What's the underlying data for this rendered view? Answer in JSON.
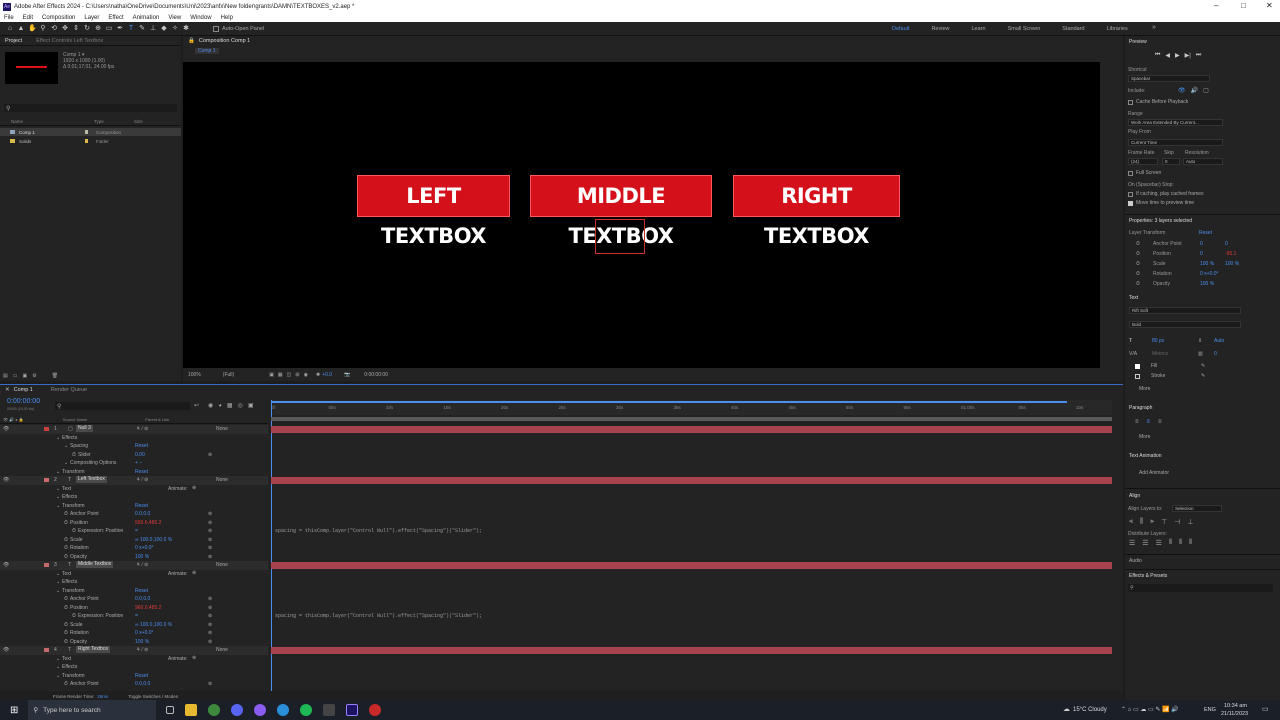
{
  "titlebar": {
    "title": "Adobe After Effects 2024 - C:\\Users\\natha\\OneDrive\\Documents\\Uni\\2023\\anfx\\New folder\\grants\\DAMN\\TEXTBOXES_v2.aep *"
  },
  "menu": [
    "File",
    "Edit",
    "Composition",
    "Layer",
    "Effect",
    "Animation",
    "View",
    "Window",
    "Help"
  ],
  "toolbar": {
    "auto_open": "Auto-Open Panel"
  },
  "workspaces": [
    "Default",
    "Review",
    "Learn",
    "Small Screen",
    "Standard",
    "Libraries"
  ],
  "project": {
    "tab": "Project",
    "effect_tab": "Effect Controls Left Textbox",
    "comp_name": "Comp 1 ▾",
    "comp_size": "1920 x 1080 (1.00)",
    "comp_duration": "Δ 0;01;17;01, 24.00 fps",
    "cols": [
      "Name",
      "Type",
      "Size"
    ],
    "items": [
      {
        "name": "Comp 1",
        "type": "Composition"
      },
      {
        "name": "Solids",
        "type": "Folder"
      }
    ]
  },
  "composition": {
    "tab": "Composition Comp 1",
    "crumb": "Comp 1"
  },
  "viewer": {
    "boxes": [
      "LEFT TEXTBOX",
      "MIDDLE TEXTBOX",
      "RIGHT TEXTBOX"
    ],
    "zoom": "100%",
    "quality": "(Full)",
    "exposure": "+0.0",
    "timecode": "0:00:00:00"
  },
  "preview": {
    "title": "Preview",
    "shortcut_label": "Shortcut",
    "shortcut": "Spacebar",
    "include": "Include:",
    "cache": "Cache Before Playback",
    "range_label": "Range",
    "range": "Work Area Extended By Current...",
    "play_from_label": "Play From",
    "play_from": "Current Time",
    "framerate_label": "Frame Rate",
    "skip_label": "Skip",
    "res_label": "Resolution",
    "framerate": "(24)",
    "skip": "0",
    "res": "Auto",
    "fullscreen": "Full Screen",
    "stop_label": "On (Spacebar) Stop:",
    "if_caching": "If caching, play cached frames",
    "move_time": "Move time to preview time"
  },
  "properties": {
    "title": "Properties: 3 layers selected",
    "layer_transform": "Layer Transform",
    "reset": "Reset",
    "rows": [
      {
        "label": "Anchor Point",
        "v1": "0",
        "v2": "0"
      },
      {
        "label": "Position",
        "v1": "0",
        "v2": "-95.1"
      },
      {
        "label": "Scale",
        "v1": "100 %",
        "v2": "100 %"
      },
      {
        "label": "Rotation",
        "v1": "0 x+0.0°",
        "v2": ""
      },
      {
        "label": "Opacity",
        "v1": "100 %",
        "v2": ""
      }
    ],
    "text_title": "Text",
    "font": "Rift Soft",
    "style": "Bold",
    "size": "80 px",
    "leading": "Auto",
    "kerning": "Metrics",
    "tracking": "0",
    "fill": "Fill",
    "stroke": "Stroke",
    "more": "More",
    "paragraph": "Paragraph",
    "text_animation": "Text Animation",
    "add_animator": "Add Animator",
    "align": "Align",
    "align_to_label": "Align Layers to:",
    "align_to": "Selection",
    "distribute": "Distribute Layers:",
    "audio": "Audio",
    "effects_presets": "Effects & Presets"
  },
  "timeline": {
    "tab": "Comp 1",
    "render_queue": "Render Queue",
    "time": "0:00:00:00",
    "fps": "00000 (24.00 fps)",
    "cols": {
      "source": "Source Name",
      "parent": "Parent & Link"
    },
    "ruler": [
      "0f",
      "05s",
      "10s",
      "15s",
      "20s",
      "25s",
      "30s",
      "35s",
      "40s",
      "45s",
      "50s",
      "55s",
      "01:00s",
      "05s",
      "10s"
    ],
    "none": "None",
    "animate": "Animate:",
    "expression": "spacing = thisComp.layer(\"Control Null\").effect(\"Spacing\")(\"Slider\");",
    "rows": [
      {
        "num": "1",
        "name": "Null 3",
        "indent": 0,
        "type": "layer",
        "value": ""
      },
      {
        "num": "",
        "name": "Effects",
        "indent": 1,
        "type": "group",
        "value": ""
      },
      {
        "num": "",
        "name": "Spacing",
        "indent": 2,
        "type": "group",
        "value": "Reset"
      },
      {
        "num": "",
        "name": "Slider",
        "indent": 3,
        "type": "prop",
        "value": "0.00"
      },
      {
        "num": "",
        "name": "Compositing Options",
        "indent": 2,
        "type": "group",
        "value": "+ −"
      },
      {
        "num": "",
        "name": "Transform",
        "indent": 1,
        "type": "group",
        "value": "Reset"
      },
      {
        "num": "2",
        "name": "Left Textbox",
        "indent": 0,
        "type": "layer",
        "value": ""
      },
      {
        "num": "",
        "name": "Text",
        "indent": 1,
        "type": "group",
        "value": ""
      },
      {
        "num": "",
        "name": "Effects",
        "indent": 1,
        "type": "group",
        "value": ""
      },
      {
        "num": "",
        "name": "Transform",
        "indent": 1,
        "type": "group",
        "value": "Reset"
      },
      {
        "num": "",
        "name": "Anchor Point",
        "indent": 2,
        "type": "prop",
        "value": "0.0,0.0"
      },
      {
        "num": "",
        "name": "Position",
        "indent": 2,
        "type": "prop",
        "value": "565.6,485.2",
        "red": true
      },
      {
        "num": "",
        "name": "Expression: Position",
        "indent": 3,
        "type": "prop",
        "value": "="
      },
      {
        "num": "",
        "name": "Scale",
        "indent": 2,
        "type": "prop",
        "value": "∞ 100.0,100.0 %"
      },
      {
        "num": "",
        "name": "Rotation",
        "indent": 2,
        "type": "prop",
        "value": "0 x+0.0°"
      },
      {
        "num": "",
        "name": "Opacity",
        "indent": 2,
        "type": "prop",
        "value": "100 %"
      },
      {
        "num": "3",
        "name": "Middle Textbox",
        "indent": 0,
        "type": "layer",
        "value": ""
      },
      {
        "num": "",
        "name": "Text",
        "indent": 1,
        "type": "group",
        "value": ""
      },
      {
        "num": "",
        "name": "Effects",
        "indent": 1,
        "type": "group",
        "value": ""
      },
      {
        "num": "",
        "name": "Transform",
        "indent": 1,
        "type": "group",
        "value": "Reset"
      },
      {
        "num": "",
        "name": "Anchor Point",
        "indent": 2,
        "type": "prop",
        "value": "0.0,0.0"
      },
      {
        "num": "",
        "name": "Position",
        "indent": 2,
        "type": "prop",
        "value": "960.0,485.2",
        "red": true
      },
      {
        "num": "",
        "name": "Expression: Position",
        "indent": 3,
        "type": "prop",
        "value": "="
      },
      {
        "num": "",
        "name": "Scale",
        "indent": 2,
        "type": "prop",
        "value": "∞ 100.0,100.0 %"
      },
      {
        "num": "",
        "name": "Rotation",
        "indent": 2,
        "type": "prop",
        "value": "0 x+0.0°"
      },
      {
        "num": "",
        "name": "Opacity",
        "indent": 2,
        "type": "prop",
        "value": "100 %"
      },
      {
        "num": "4",
        "name": "Right Textbox",
        "indent": 0,
        "type": "layer",
        "value": ""
      },
      {
        "num": "",
        "name": "Text",
        "indent": 1,
        "type": "group",
        "value": ""
      },
      {
        "num": "",
        "name": "Effects",
        "indent": 1,
        "type": "group",
        "value": ""
      },
      {
        "num": "",
        "name": "Transform",
        "indent": 1,
        "type": "group",
        "value": "Reset"
      },
      {
        "num": "",
        "name": "Anchor Point",
        "indent": 2,
        "type": "prop",
        "value": "0.0,0.0"
      }
    ],
    "render_time_label": "Frame Render Time:",
    "render_time": "26ms",
    "toggle": "Toggle Switches / Modes"
  },
  "taskbar": {
    "search": "Type here to search",
    "weather": "15°C Cloudy",
    "lang": "ENG",
    "time": "10:34 am",
    "date": "21/11/2023"
  }
}
